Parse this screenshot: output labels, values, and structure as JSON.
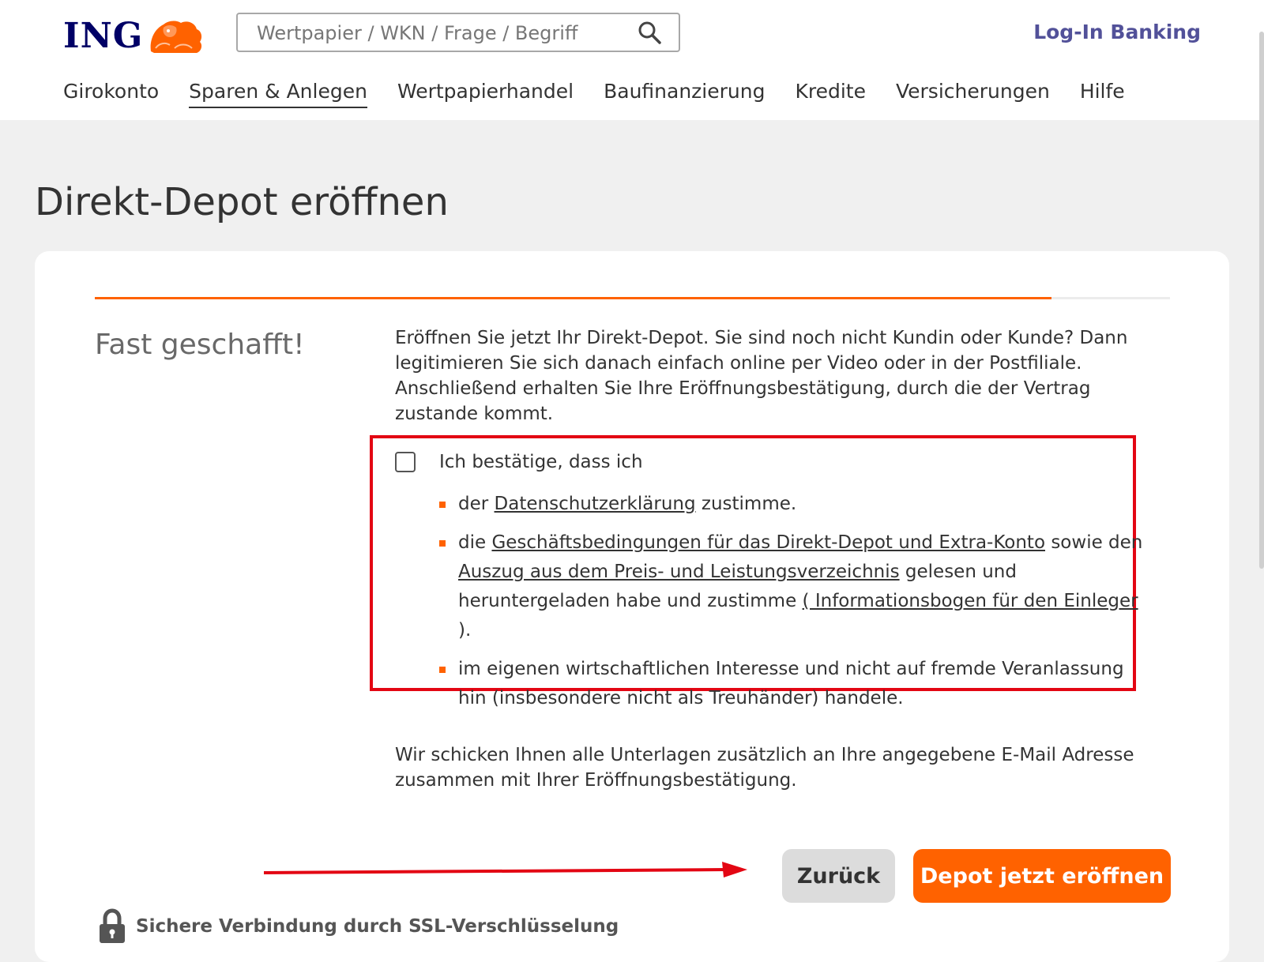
{
  "header": {
    "logo_text": "ING",
    "search": {
      "placeholder": "Wertpapier / WKN / Frage / Begriff"
    },
    "login_label": "Log-In Banking",
    "nav": [
      {
        "label": "Girokonto"
      },
      {
        "label": "Sparen & Anlegen",
        "active": true
      },
      {
        "label": "Wertpapierhandel"
      },
      {
        "label": "Baufinanzierung"
      },
      {
        "label": "Kredite"
      },
      {
        "label": "Versicherungen"
      },
      {
        "label": "Hilfe"
      }
    ]
  },
  "page": {
    "title": "Direkt-Depot eröffnen"
  },
  "progress": {
    "fraction": 0.89
  },
  "step": {
    "title": "Fast geschafft!",
    "intro": "Eröffnen Sie jetzt Ihr Direkt-Depot. Sie sind noch nicht Kundin oder Kunde? Dann legitimieren Sie sich danach einfach online per Video oder in der Postfiliale. Anschließend erhalten Sie Ihre Eröffnungsbestätigung, durch die der Vertrag zustande kommt."
  },
  "consent": {
    "checked": false,
    "label": "Ich bestätige, dass ich",
    "items": [
      {
        "pre": "der ",
        "link": "Datenschutzerklärung",
        "post": " zustimme."
      },
      {
        "pre": "die ",
        "link1": "Geschäftsbedingungen für das Direkt-Depot und Extra-Konto",
        "mid1": " sowie den ",
        "link2": "Auszug aus dem Preis- und Leistungsverzeichnis",
        "mid2": " gelesen und heruntergeladen habe und zustimme ",
        "link3": "( Informationsbogen für den Einleger",
        "post": " )."
      },
      {
        "text": "im eigenen wirtschaftlichen Interesse und nicht auf fremde Veranlassung hin (insbesondere nicht als Treuhänder) handele."
      }
    ]
  },
  "mail_note": "Wir schicken Ihnen alle Unterlagen zusätzlich an Ihre angegebene E-Mail Adresse zusammen mit Ihrer Eröffnungsbestätigung.",
  "buttons": {
    "back": "Zurück",
    "open": "Depot jetzt eröffnen"
  },
  "ssl_text": "Sichere Verbindung durch SSL-Verschlüsselung",
  "colors": {
    "brand_orange": "#ff6200",
    "brand_navy": "#000066",
    "login_purple": "#525199",
    "annotation_red": "#e30613"
  },
  "icons": [
    "lion-logo-icon",
    "search-icon",
    "checkbox",
    "lock-icon",
    "red-arrow-annotation"
  ]
}
